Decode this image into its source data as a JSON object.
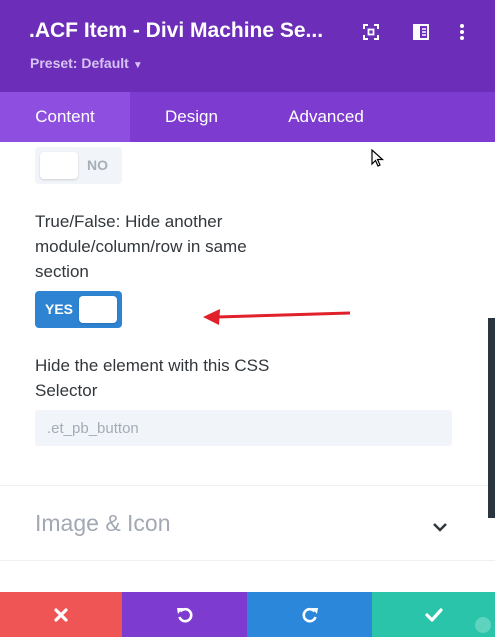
{
  "header": {
    "title": ".ACF Item - Divi Machine Se...",
    "preset_label": "Preset: Default",
    "icons": [
      "focus-icon",
      "sidebar-toggle-icon",
      "more-options-icon"
    ]
  },
  "tabs": [
    {
      "label": "Content",
      "active": true
    },
    {
      "label": "Design",
      "active": false
    },
    {
      "label": "Advanced",
      "active": false
    }
  ],
  "settings": {
    "previous_toggle": {
      "state": "NO"
    },
    "hide_other_module": {
      "label": "True/False: Hide another module/column/row in same section",
      "state": "YES"
    },
    "css_selector": {
      "label": "Hide the element with this CSS Selector",
      "value": "",
      "placeholder": ".et_pb_button"
    }
  },
  "sections": [
    {
      "title": "Image & Icon",
      "expanded": false
    }
  ],
  "footer": {
    "buttons": [
      {
        "name": "discard-button",
        "icon": "close-icon",
        "color": "#ef5555"
      },
      {
        "name": "undo-button",
        "icon": "undo-icon",
        "color": "#7e3bd0"
      },
      {
        "name": "redo-button",
        "icon": "redo-icon",
        "color": "#2b87da"
      },
      {
        "name": "save-button",
        "icon": "check-icon",
        "color": "#29c4a9"
      }
    ]
  },
  "colors": {
    "header_bg": "#6c2eb9",
    "tabs_bg": "#7d3bcf",
    "toggle_on": "#2e84d3",
    "annotation_arrow": "#e0202a"
  }
}
